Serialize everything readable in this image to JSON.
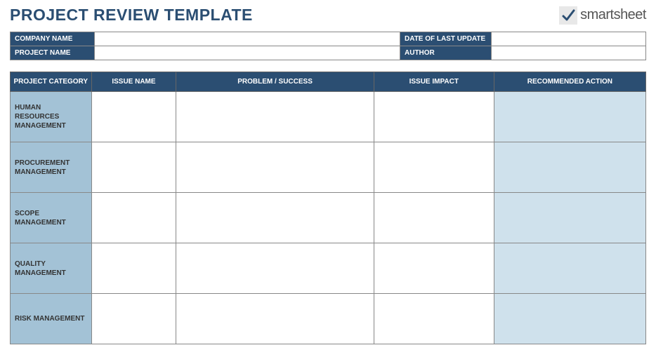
{
  "title": "PROJECT REVIEW TEMPLATE",
  "brand": {
    "name": "smartsheet"
  },
  "meta": {
    "company_label": "COMPANY NAME",
    "company_value": "",
    "project_label": "PROJECT NAME",
    "project_value": "",
    "date_label": "DATE OF LAST UPDATE",
    "date_value": "",
    "author_label": "AUTHOR",
    "author_value": ""
  },
  "columns": {
    "category": "PROJECT CATEGORY",
    "issue": "ISSUE NAME",
    "problem": "PROBLEM / SUCCESS",
    "impact": "ISSUE IMPACT",
    "action": "RECOMMENDED ACTION"
  },
  "rows": [
    {
      "category": "HUMAN RESOURCES MANAGEMENT",
      "issue": "",
      "problem": "",
      "impact": "",
      "action": ""
    },
    {
      "category": "PROCUREMENT MANAGEMENT",
      "issue": "",
      "problem": "",
      "impact": "",
      "action": ""
    },
    {
      "category": "SCOPE MANAGEMENT",
      "issue": "",
      "problem": "",
      "impact": "",
      "action": ""
    },
    {
      "category": "QUALITY MANAGEMENT",
      "issue": "",
      "problem": "",
      "impact": "",
      "action": ""
    },
    {
      "category": "RISK MANAGEMENT",
      "issue": "",
      "problem": "",
      "impact": "",
      "action": ""
    }
  ]
}
